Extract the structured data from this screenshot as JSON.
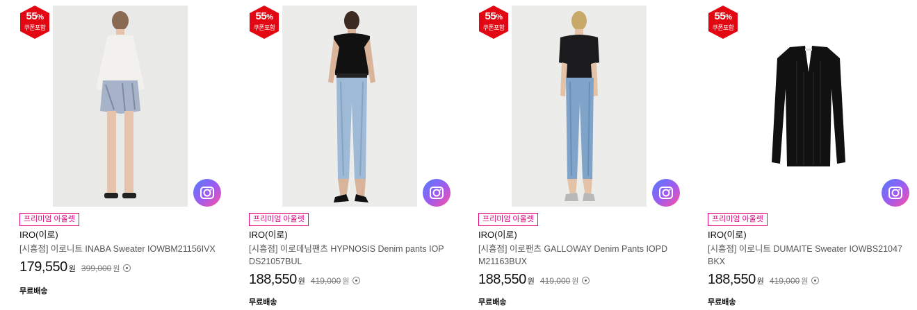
{
  "colors": {
    "badge": "#e30613",
    "tag": "#e2007b",
    "cam_gradient": [
      "#4f7dff",
      "#9b5cf0",
      "#ff4fa3"
    ]
  },
  "products": [
    {
      "discount": "55",
      "discount_sign": "%",
      "coupon": "쿠폰포함",
      "tag": "프리미엄 아울렛",
      "brand": "IRO(이로)",
      "name": "[시흥점] 이로니트 INABA Sweater IOWBM21156IVX",
      "price": "179,550",
      "currency": "원",
      "original_price": "399,000",
      "original_currency": "원",
      "shipping": "무료배송",
      "image_icon": "model-photo",
      "camera_icon": "camera-icon"
    },
    {
      "discount": "55",
      "discount_sign": "%",
      "coupon": "쿠폰포함",
      "tag": "프리미엄 아울렛",
      "brand": "IRO(이로)",
      "name": "[시흥점] 이로데님팬츠 HYPNOSIS Denim pants IOPDS21057BUL",
      "price": "188,550",
      "currency": "원",
      "original_price": "419,000",
      "original_currency": "원",
      "shipping": "무료배송",
      "image_icon": "model-photo",
      "camera_icon": "camera-icon"
    },
    {
      "discount": "55",
      "discount_sign": "%",
      "coupon": "쿠폰포함",
      "tag": "프리미엄 아울렛",
      "brand": "IRO(이로)",
      "name": "[시흥점] 이로팬츠 GALLOWAY Denim Pants IOPDM21163BUX",
      "price": "188,550",
      "currency": "원",
      "original_price": "419,000",
      "original_currency": "원",
      "shipping": "무료배송",
      "image_icon": "model-photo",
      "camera_icon": "camera-icon"
    },
    {
      "discount": "55",
      "discount_sign": "%",
      "coupon": "쿠폰포함",
      "tag": "프리미엄 아울렛",
      "brand": "IRO(이로)",
      "name": "[시흥점] 이로니트 DUMAITE Sweater IOWBS21047BKX",
      "price": "188,550",
      "currency": "원",
      "original_price": "419,000",
      "original_currency": "원",
      "shipping": "무료배송",
      "image_icon": "product-photo",
      "camera_icon": "camera-icon"
    }
  ]
}
